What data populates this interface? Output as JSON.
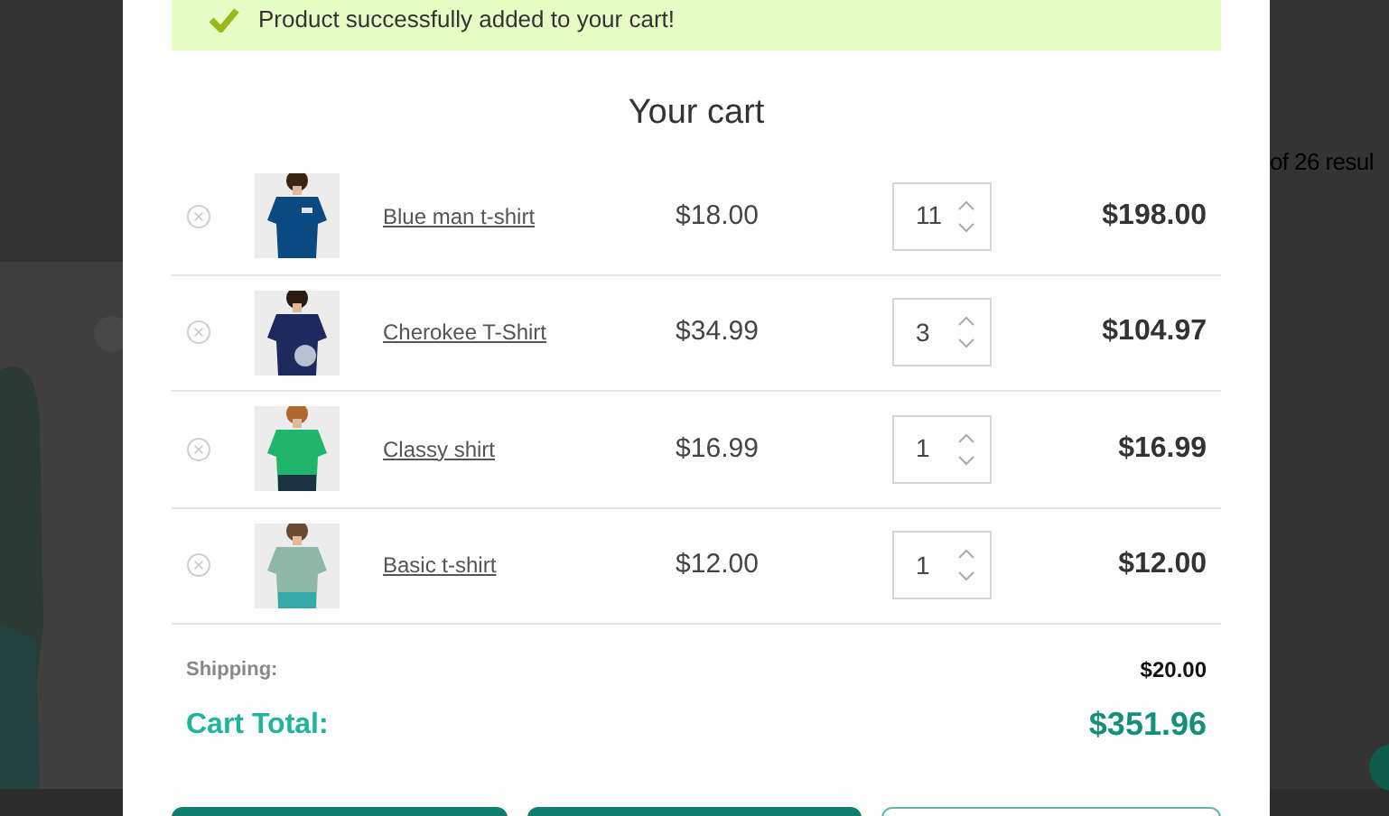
{
  "background": {
    "results_text": "of 26 resul"
  },
  "banner": {
    "message": "Product successfully added to your cart!"
  },
  "cart": {
    "title": "Your cart",
    "items": [
      {
        "name": "Blue man t-shirt",
        "price": "$18.00",
        "quantity": "11",
        "subtotal": "$198.00"
      },
      {
        "name": "Cherokee T-Shirt",
        "price": "$34.99",
        "quantity": "3",
        "subtotal": "$104.97"
      },
      {
        "name": "Classy shirt",
        "price": "$16.99",
        "quantity": "1",
        "subtotal": "$16.99"
      },
      {
        "name": "Basic t-shirt",
        "price": "$12.00",
        "quantity": "1",
        "subtotal": "$12.00"
      }
    ]
  },
  "totals": {
    "shipping_label": "Shipping:",
    "shipping": "$20.00",
    "total_label": "Cart Total:",
    "total": "$351.96"
  },
  "buttons": [
    {
      "kind": "filled"
    },
    {
      "kind": "filled"
    },
    {
      "kind": "outline"
    }
  ]
}
